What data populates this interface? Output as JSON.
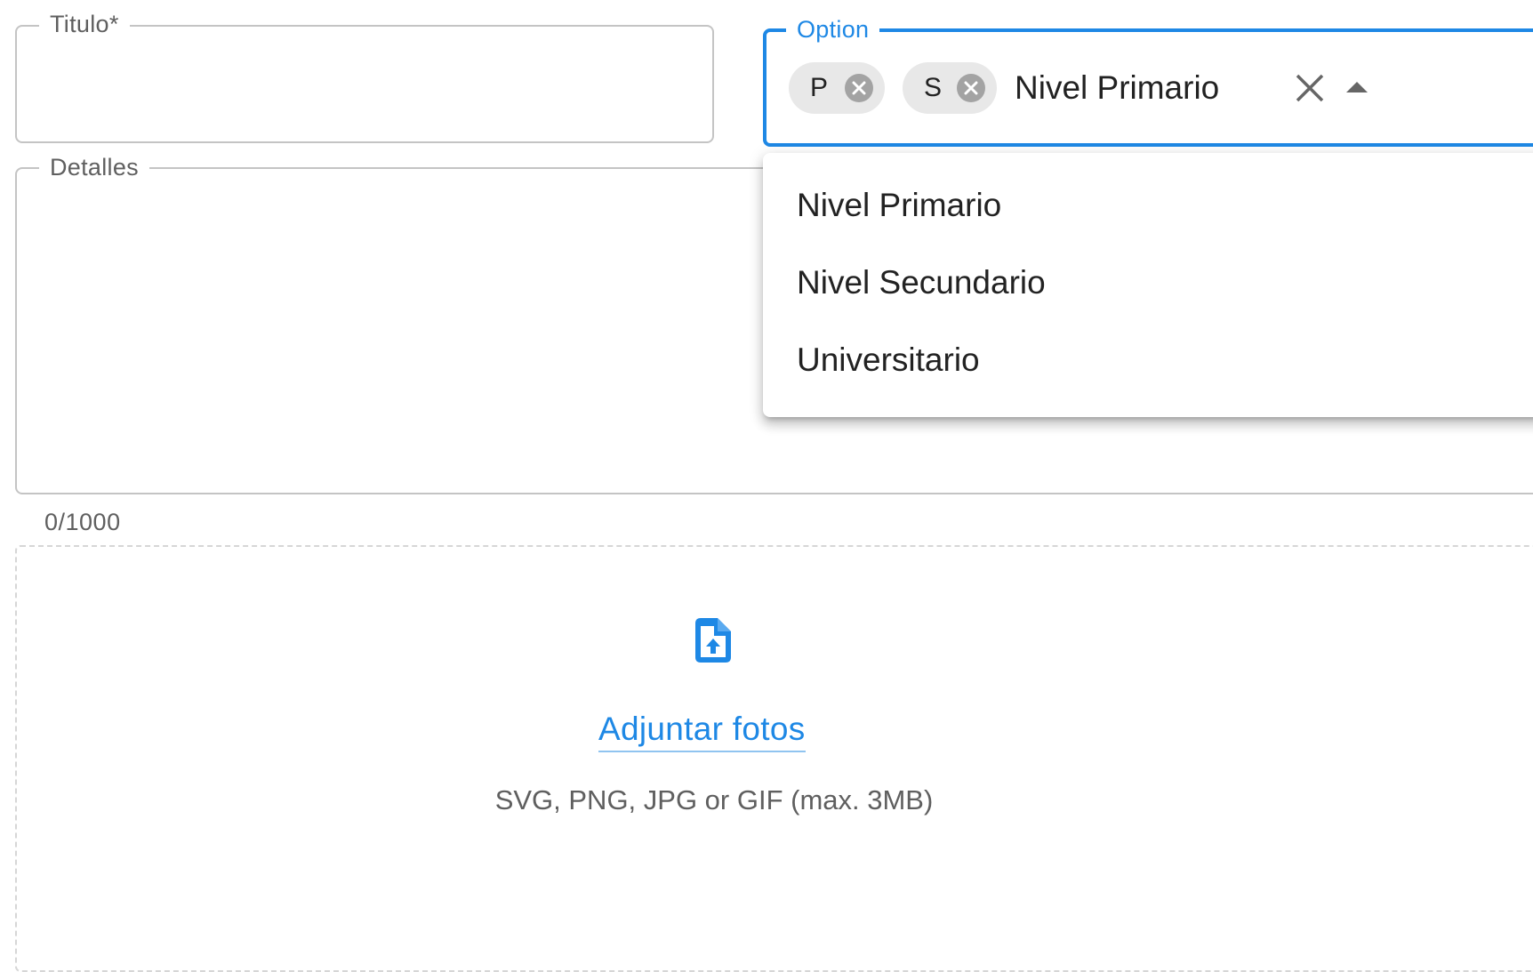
{
  "form": {
    "titulo": {
      "label": "Titulo*",
      "value": ""
    },
    "detalles": {
      "label": "Detalles",
      "value": "",
      "counter": "0/1000"
    },
    "option": {
      "label": "Option",
      "input_value": "Nivel Primario",
      "chips": [
        {
          "label": "P"
        },
        {
          "label": "S"
        }
      ],
      "options": [
        "Nivel Primario",
        "Nivel Secundario",
        "Universitario"
      ],
      "accent_color": "#1e88e5",
      "open": true
    },
    "upload": {
      "icon": "upload-file-icon",
      "link_label": "Adjuntar fotos",
      "hint": "SVG, PNG, JPG or GIF (max. 3MB)"
    }
  }
}
